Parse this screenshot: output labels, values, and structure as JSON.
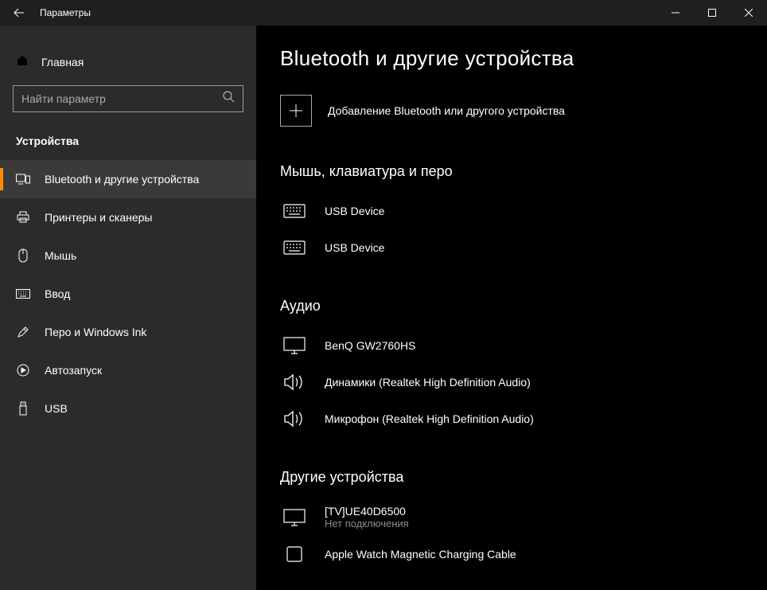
{
  "titlebar": {
    "title": "Параметры"
  },
  "sidebar": {
    "home": "Главная",
    "search_placeholder": "Найти параметр",
    "category": "Устройства",
    "items": [
      {
        "label": "Bluetooth и другие устройства"
      },
      {
        "label": "Принтеры и сканеры"
      },
      {
        "label": "Мышь"
      },
      {
        "label": "Ввод"
      },
      {
        "label": "Перо и Windows Ink"
      },
      {
        "label": "Автозапуск"
      },
      {
        "label": "USB"
      }
    ]
  },
  "main": {
    "title": "Bluetooth и другие устройства",
    "add_label": "Добавление Bluetooth или другого устройства",
    "sections": {
      "s0": {
        "title": "Мышь, клавиатура и перо",
        "devices": [
          {
            "name": "USB Device"
          },
          {
            "name": "USB Device"
          }
        ]
      },
      "s1": {
        "title": "Аудио",
        "devices": [
          {
            "name": "BenQ GW2760HS"
          },
          {
            "name": "Динамики (Realtek High Definition Audio)"
          },
          {
            "name": "Микрофон (Realtek High Definition Audio)"
          }
        ]
      },
      "s2": {
        "title": "Другие устройства",
        "devices": [
          {
            "name": "[TV]UE40D6500",
            "status": "Нет подключения"
          },
          {
            "name": "Apple Watch Magnetic Charging Cable"
          }
        ]
      }
    }
  }
}
